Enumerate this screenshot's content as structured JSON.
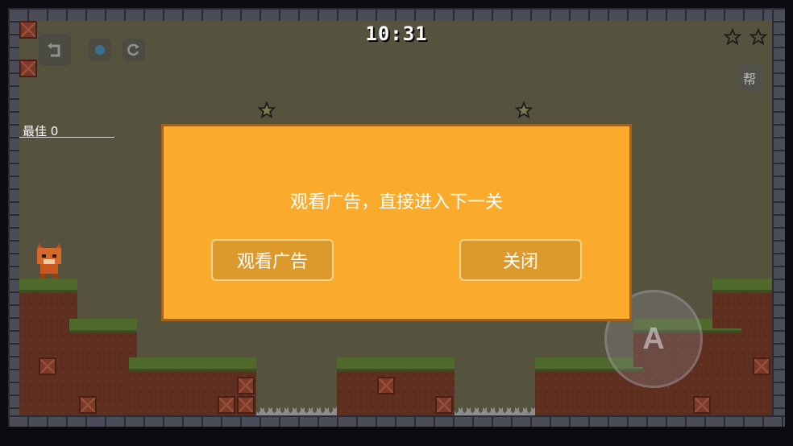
{
  "hud": {
    "timer": "10:31",
    "best_label": "最佳 0",
    "help_label": "帮",
    "stars_collected": 0,
    "stars_total": 2
  },
  "modal": {
    "message": "观看广告，直接进入下一关",
    "watch_ad_label": "观看广告",
    "close_label": "关闭"
  },
  "controls": {
    "jump_label": "A"
  },
  "icons": {
    "back": "back-arrow-icon",
    "sound": "sound-dot-icon",
    "restart": "restart-icon",
    "star": "star-outline-icon"
  },
  "colors": {
    "modal_bg": "#fbab2b",
    "modal_border": "#a4611a",
    "button_bg": "#dc9a2c",
    "background": "#55523e"
  }
}
